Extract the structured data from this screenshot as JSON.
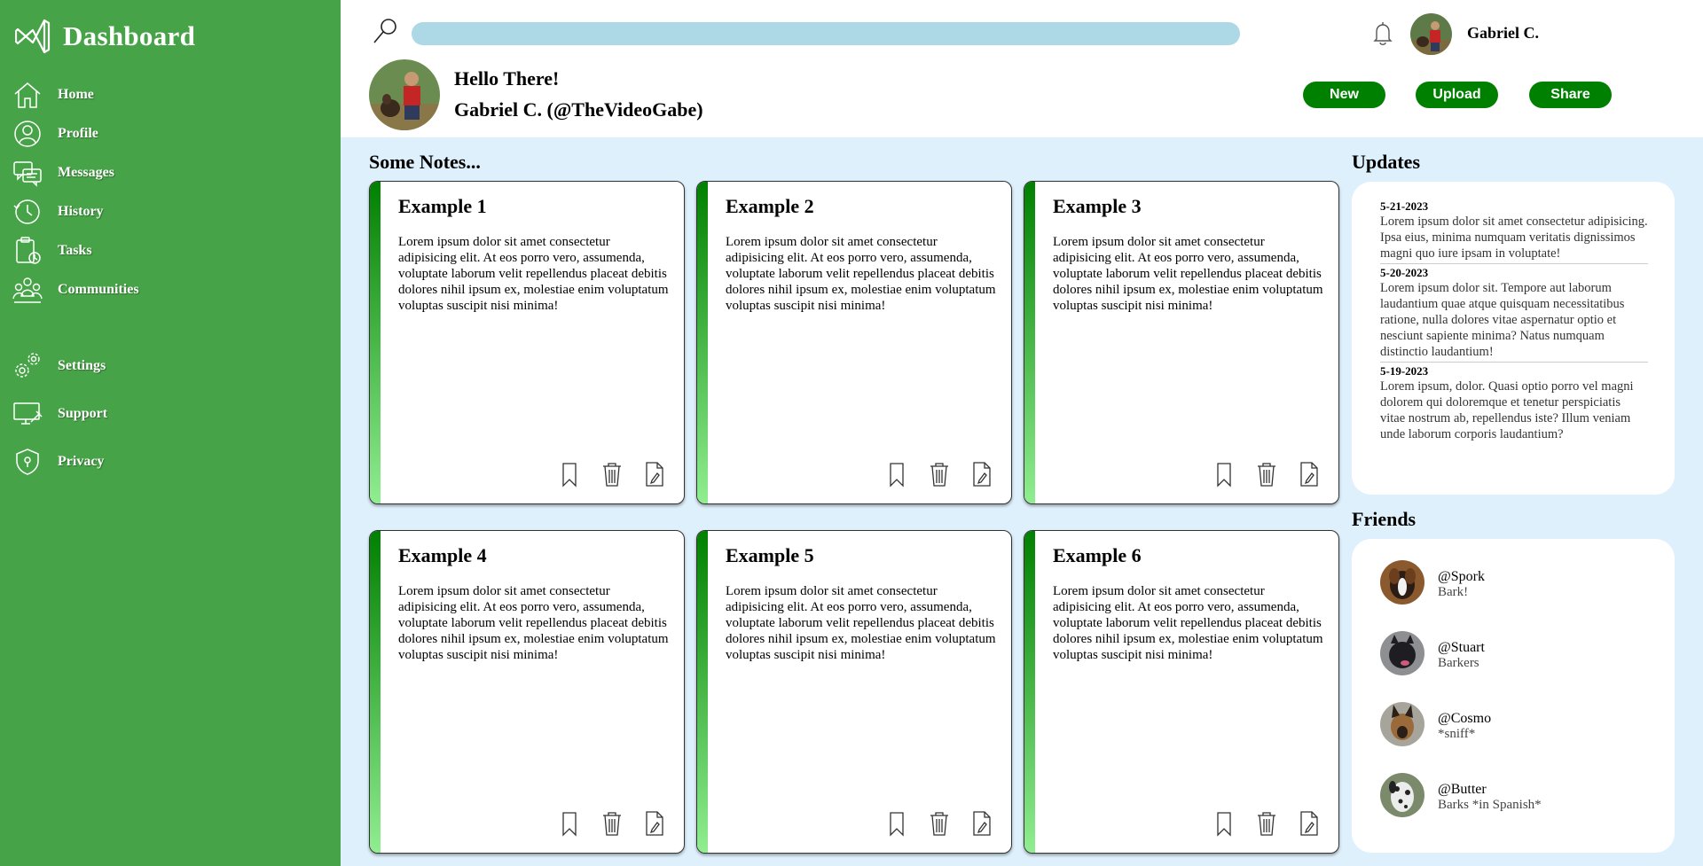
{
  "app": {
    "title": "Dashboard"
  },
  "sidebar": {
    "items": [
      {
        "label": "Home",
        "icon": "home-icon"
      },
      {
        "label": "Profile",
        "icon": "profile-icon"
      },
      {
        "label": "Messages",
        "icon": "messages-icon"
      },
      {
        "label": "History",
        "icon": "history-icon"
      },
      {
        "label": "Tasks",
        "icon": "tasks-icon"
      },
      {
        "label": "Communities",
        "icon": "communities-icon"
      },
      {
        "label": "Settings",
        "icon": "settings-icon"
      },
      {
        "label": "Support",
        "icon": "support-icon"
      },
      {
        "label": "Privacy",
        "icon": "privacy-icon"
      }
    ]
  },
  "header": {
    "search_placeholder": "",
    "username": "Gabriel C.",
    "greeting": "Hello There!",
    "full_name": "Gabriel C. (@TheVideoGabe)",
    "buttons": {
      "new": "New",
      "upload": "Upload",
      "share": "Share"
    }
  },
  "notes": {
    "title": "Some Notes...",
    "items": [
      {
        "title": "Example 1",
        "body": "Lorem ipsum dolor sit amet consectetur adipisicing elit. At eos porro vero, assumenda, voluptate laborum velit repellendus placeat debitis dolores nihil ipsum ex, molestiae enim voluptatum voluptas suscipit nisi minima!"
      },
      {
        "title": "Example 2",
        "body": "Lorem ipsum dolor sit amet consectetur adipisicing elit. At eos porro vero, assumenda, voluptate laborum velit repellendus placeat debitis dolores nihil ipsum ex, molestiae enim voluptatum voluptas suscipit nisi minima!"
      },
      {
        "title": "Example 3",
        "body": "Lorem ipsum dolor sit amet consectetur adipisicing elit. At eos porro vero, assumenda, voluptate laborum velit repellendus placeat debitis dolores nihil ipsum ex, molestiae enim voluptatum voluptas suscipit nisi minima!"
      },
      {
        "title": "Example 4",
        "body": "Lorem ipsum dolor sit amet consectetur adipisicing elit. At eos porro vero, assumenda, voluptate laborum velit repellendus placeat debitis dolores nihil ipsum ex, molestiae enim voluptatum voluptas suscipit nisi minima!"
      },
      {
        "title": "Example 5",
        "body": "Lorem ipsum dolor sit amet consectetur adipisicing elit. At eos porro vero, assumenda, voluptate laborum velit repellendus placeat debitis dolores nihil ipsum ex, molestiae enim voluptatum voluptas suscipit nisi minima!"
      },
      {
        "title": "Example 6",
        "body": "Lorem ipsum dolor sit amet consectetur adipisicing elit. At eos porro vero, assumenda, voluptate laborum velit repellendus placeat debitis dolores nihil ipsum ex, molestiae enim voluptatum voluptas suscipit nisi minima!"
      }
    ]
  },
  "updates": {
    "title": "Updates",
    "items": [
      {
        "date": "5-21-2023",
        "text": "Lorem ipsum dolor sit amet consectetur adipisicing. Ipsa eius, minima numquam veritatis dignissimos magni quo iure ipsam in voluptate!"
      },
      {
        "date": "5-20-2023",
        "text": "Lorem ipsum dolor sit. Tempore aut laborum laudantium quae atque quisquam necessitatibus ratione, nulla dolores vitae aspernatur optio et nesciunt sapiente minima? Natus numquam distinctio laudantium!"
      },
      {
        "date": "5-19-2023",
        "text": "Lorem ipsum, dolor. Quasi optio porro vel magni dolorem qui doloremque et tenetur perspiciatis vitae nostrum ab, repellendus iste? Illum veniam unde laborum corporis laudantium?"
      }
    ]
  },
  "friends": {
    "title": "Friends",
    "items": [
      {
        "handle": "@Spork",
        "status": "Bark!"
      },
      {
        "handle": "@Stuart",
        "status": "Barkers"
      },
      {
        "handle": "@Cosmo",
        "status": "*sniff*"
      },
      {
        "handle": "@Butter",
        "status": "Barks *in Spanish*"
      }
    ]
  },
  "colors": {
    "sidebar": "#47a347",
    "accent": "#008000",
    "search_bar": "#add8e6",
    "content_bg": "#def0fc"
  }
}
